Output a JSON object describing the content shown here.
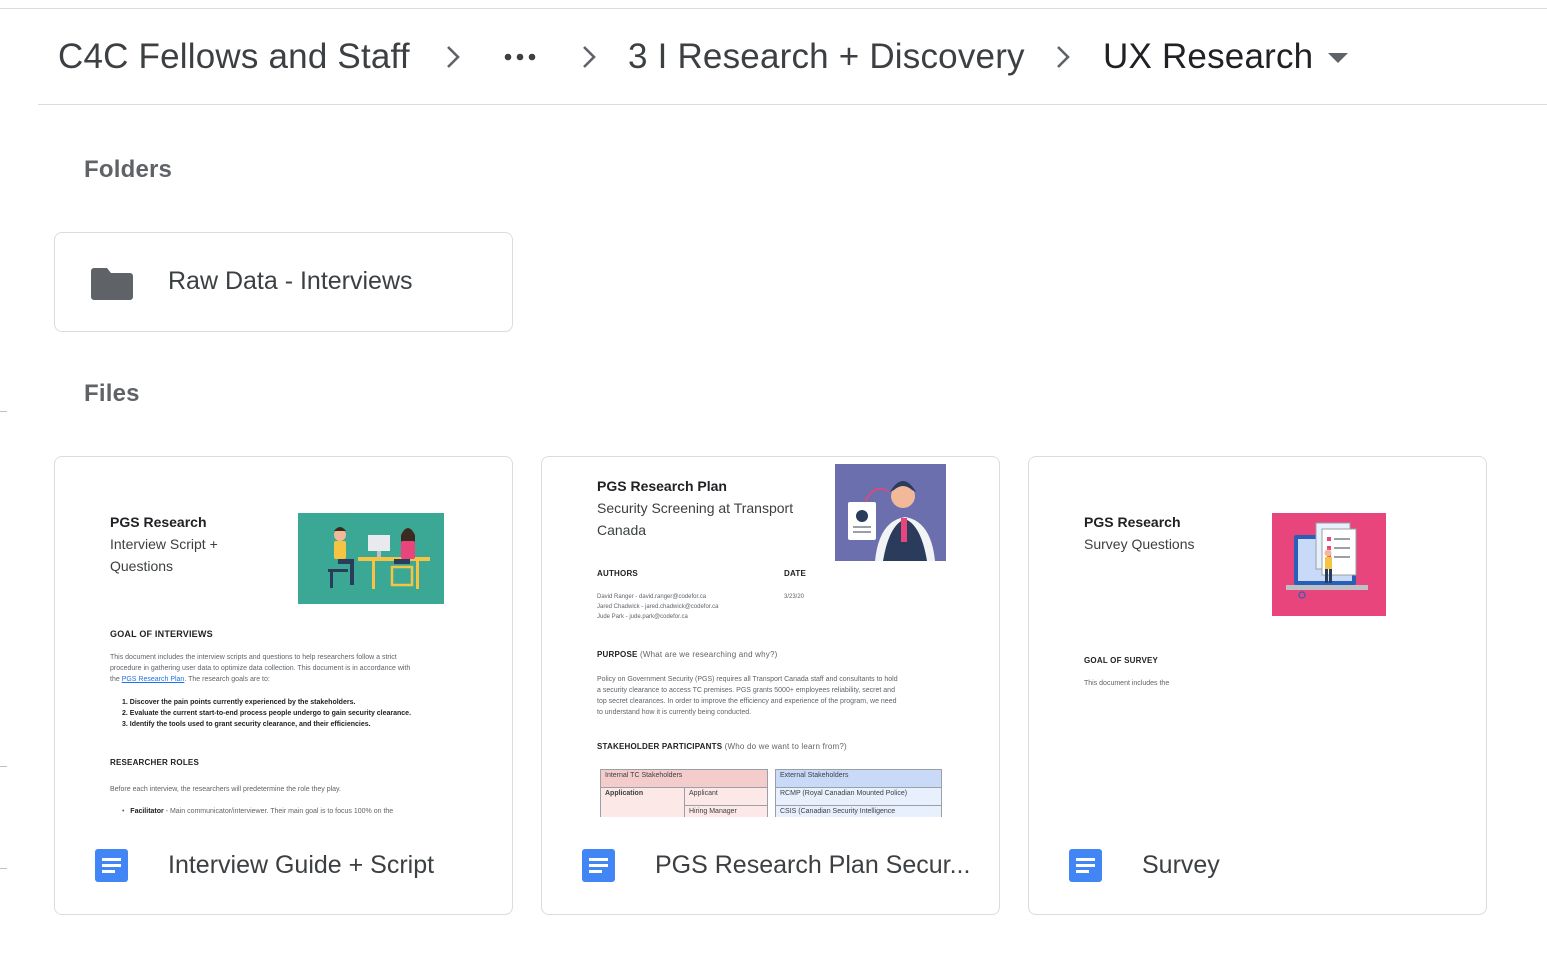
{
  "breadcrumb": {
    "items": [
      {
        "label": "C4C Fellows and Staff"
      },
      {
        "label": "3 I Research + Discovery"
      },
      {
        "label": "UX Research"
      }
    ],
    "more_label": "•••"
  },
  "sections": {
    "folders_label": "Folders",
    "files_label": "Files"
  },
  "folders": [
    {
      "name": "Raw Data - Interviews",
      "icon": "folder-icon"
    }
  ],
  "files": [
    {
      "name": "Interview Guide + Script",
      "icon": "google-docs-icon",
      "preview": {
        "title": "PGS Research",
        "subtitle1": "Interview Script +",
        "subtitle2": "Questions",
        "goal_heading": "GOAL OF INTERVIEWS",
        "goal_text1": "This document includes the interview scripts and questions to help researchers follow a strict",
        "goal_text2": "procedure in gathering user data to optimize data collection. This document is in accordance with",
        "goal_text3_pre": "the ",
        "goal_link": "PGS Research Plan",
        "goal_text3_post": ". The research goals are to:",
        "goals": [
          "1.   Discover the pain points currently experienced by the stakeholders.",
          "2.   Evaluate the current start-to-end process people undergo to gain security clearance.",
          "3.   Identify the tools used to grant security clearance, and their efficiencies."
        ],
        "roles_heading": "RESEARCHER ROLES",
        "roles_text": "Before each interview, the researchers will predetermine the role they play.",
        "roles_bullet_bold": "Facilitator",
        "roles_bullet_text": " - Main communicator/interviewer. Their main goal is to focus 100% on the"
      }
    },
    {
      "name": "PGS Research Plan Secur...",
      "icon": "google-docs-icon",
      "preview": {
        "title": "PGS Research Plan",
        "subtitle1": "Security Screening at Transport",
        "subtitle2": "Canada",
        "authors_heading": "AUTHORS",
        "date_heading": "DATE",
        "authors": [
          "David Ranger - david.ranger@codefor.ca",
          "Jared Chadwick - jared.chadwick@codefor.ca",
          "Jude Park -  jude.park@codefor.ca"
        ],
        "date": "3/23/20",
        "purpose_heading": "PURPOSE",
        "purpose_sub": " (What are we researching and why?)",
        "purpose_text": [
          "Policy on Government Security (PGS) requires all Transport Canada staff and consultants to hold",
          "a security clearance to access TC premises. PGS grants 5000+ employees reliability, secret and",
          "top secret clearances. In order to improve the efficiency and experience of the program, we need",
          "to understand how it is currently being conducted."
        ],
        "stakeholder_heading": "STAKEHOLDER PARTICIPANTS",
        "stakeholder_sub": "  (Who do we want to learn from?)",
        "internal_header": "Internal TC Stakeholders",
        "external_header": "External Stakeholders",
        "internal_rows": [
          [
            "Application",
            "Applicant"
          ],
          [
            "",
            "Hiring Manager"
          ]
        ],
        "external_rows": [
          "RCMP (Royal Canadian Mounted Police)",
          "CSIS (Canadian Security Intelligence"
        ]
      }
    },
    {
      "name": "Survey",
      "icon": "google-docs-icon",
      "preview": {
        "title": "PGS Research",
        "subtitle1": "Survey Questions",
        "goal_heading": "GOAL OF SURVEY",
        "goal_text": "This document includes the"
      }
    }
  ],
  "colors": {
    "doc_blue": "#4285f4",
    "folder_gray": "#5f6368",
    "teal_illustration": "#3aa894",
    "purple_illustration": "#6b6fae",
    "pink_illustration": "#e8457c",
    "internal_table": "#f4cccc",
    "external_table": "#c9daf8"
  }
}
